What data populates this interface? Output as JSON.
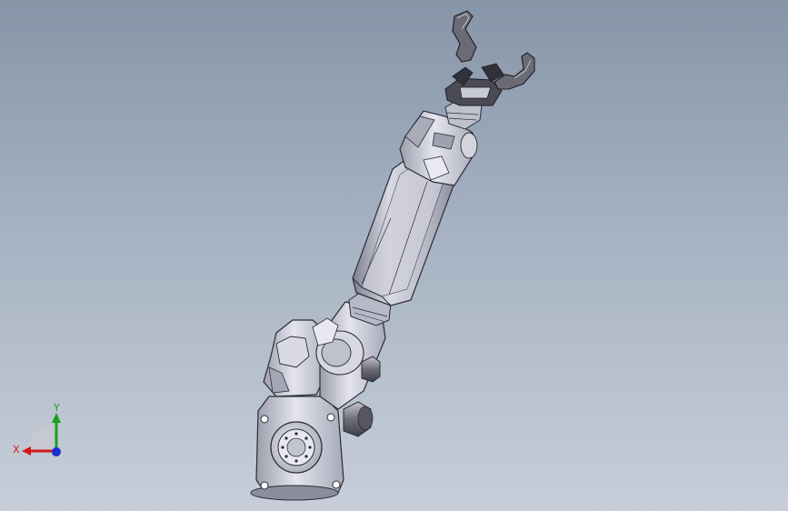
{
  "viewport": {
    "background_top": "#8795a8",
    "background_bottom": "#c7ced9"
  },
  "model": {
    "part_colors": {
      "body": "#c9cbd6",
      "shadow": "#8a8d9c",
      "edge": "#2a2c36",
      "dark": "#55565f"
    }
  },
  "triad": {
    "x_label": "X",
    "y_label": "Y",
    "x_color": "#d01818",
    "y_color": "#18a018",
    "z_color": "#1830d0"
  }
}
